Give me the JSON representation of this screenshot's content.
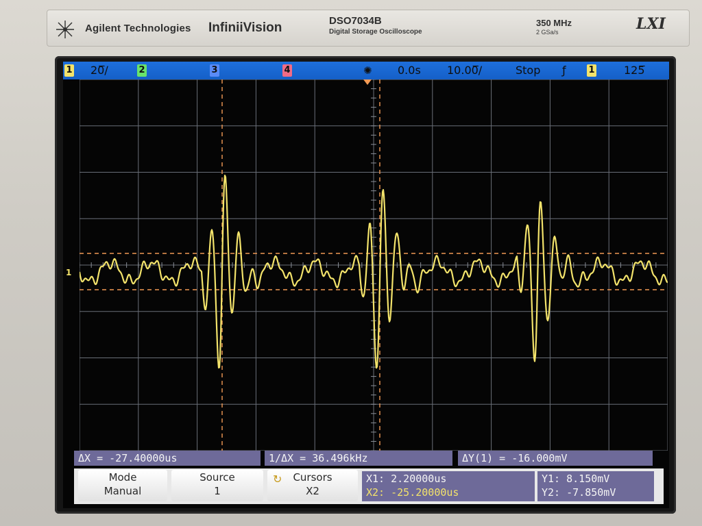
{
  "header": {
    "brand": "Agilent Technologies",
    "product": "InfiniiVision",
    "model": "DSO7034B",
    "model_sub": "Digital Storage Oscilloscope",
    "bandwidth": "350 MHz",
    "sample_rate": "2 GSa/s",
    "lxi": "LXI"
  },
  "status": {
    "ch1_label": "1",
    "ch1_scale": "20̅/",
    "ch2_label": "2",
    "ch3_label": "3",
    "ch4_label": "4",
    "time_ref": "0.0s",
    "time_scale": "10.00̅/",
    "run_state": "Stop",
    "trigger_slope": "ƒ",
    "trigger_source": "1",
    "trigger_level": "125̅"
  },
  "channel_marker": "1",
  "measurements": {
    "delta_x": "ΔX = -27.40000us",
    "inv_delta_x": "1/ΔX = 36.496kHz",
    "delta_y": "ΔY(1) = -16.000mV"
  },
  "softkeys": {
    "mode_title": "Mode",
    "mode_value": "Manual",
    "source_title": "Source",
    "source_value": "1",
    "cursors_title": "Cursors",
    "cursors_value": "X2"
  },
  "cursor_readout": {
    "x1": "X1: 2.20000us",
    "x2": "X2: -25.20000us",
    "y1": "Y1: 8.150mV",
    "y2": "Y2: -7.850mV"
  },
  "colors": {
    "ch1": "#f3e36b",
    "ch2": "#69e36a",
    "ch3": "#5a8bf7",
    "ch4": "#f26b86",
    "status_bar": "#1560c8",
    "cursor": "#f29a55",
    "measurement_bg": "#6e6a99"
  },
  "icons": {
    "brand": "starburst-logo-icon",
    "time_ref": "sun-icon",
    "cursors": "cursor-knob-icon"
  }
}
